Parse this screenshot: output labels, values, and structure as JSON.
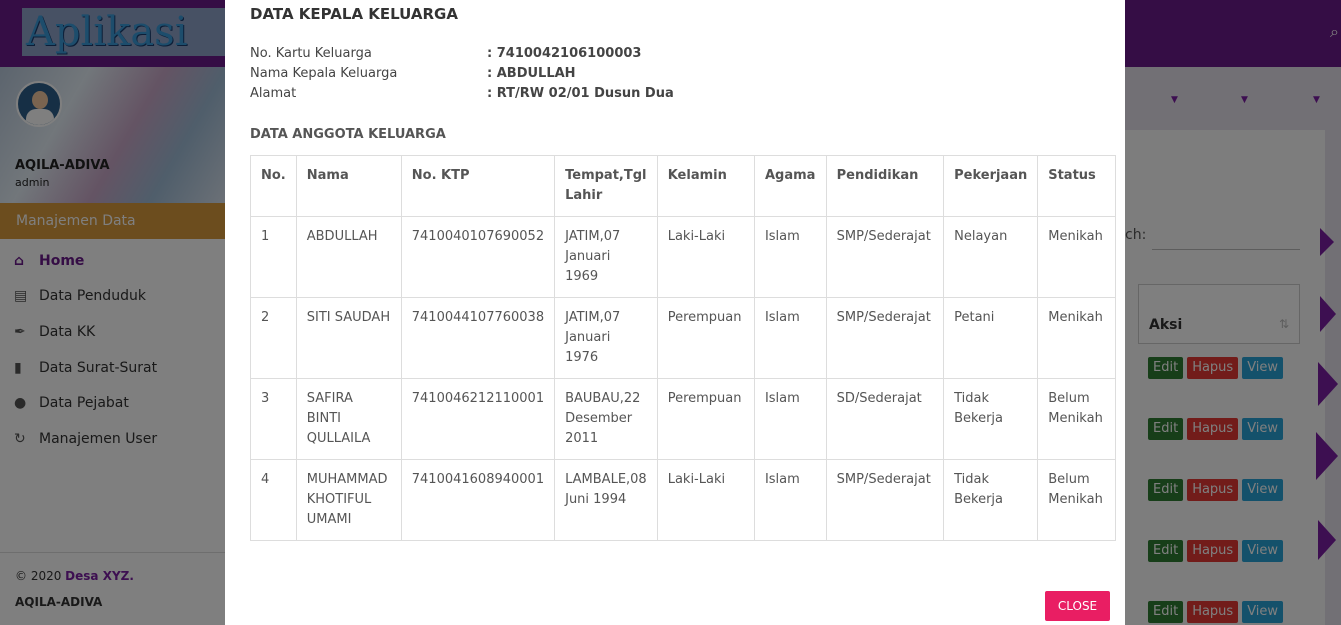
{
  "app": {
    "logo_text": "Aplikasi Admin",
    "profile_name": "AQILA-ADIVA",
    "profile_role": "admin",
    "menu_header": "Manajemen Data",
    "menu": [
      {
        "label": "Home",
        "icon": "home-icon"
      },
      {
        "label": "Data Penduduk",
        "icon": "list-icon"
      },
      {
        "label": "Data KK",
        "icon": "paperclip-icon"
      },
      {
        "label": "Data Surat-Surat",
        "icon": "file-icon"
      },
      {
        "label": "Data Pejabat",
        "icon": "user-icon"
      },
      {
        "label": "Manajemen User",
        "icon": "refresh-icon"
      }
    ],
    "footer": {
      "copyright": "© 2020 ",
      "brand": "Desa XYZ.",
      "app_name": "AQILA-ADIVA"
    },
    "search_label": "ch:",
    "aksi_header": "Aksi",
    "row_buttons": {
      "edit": "Edit",
      "hapus": "Hapus",
      "view": "View"
    },
    "colors": {
      "primary": "#6a1b8a",
      "edit": "#2e7d32",
      "hapus": "#e53935",
      "view": "#29a3d6",
      "close": "#e91e63"
    }
  },
  "modal": {
    "title": "DATA KEPALA KELUARGA",
    "info": [
      {
        "label": "No. Kartu Keluarga",
        "value": ": 7410042106100003"
      },
      {
        "label": "Nama Kepala Keluarga",
        "value": ": ABDULLAH"
      },
      {
        "label": "Alamat",
        "value": ": RT/RW 02/01 Dusun Dua"
      }
    ],
    "members_title": "DATA ANGGOTA KELUARGA",
    "columns": [
      "No.",
      "Nama",
      "No. KTP",
      "Tempat,Tgl Lahir",
      "Kelamin",
      "Agama",
      "Pendidikan",
      "Pekerjaan",
      "Status"
    ],
    "rows": [
      [
        "1",
        "ABDULLAH",
        "7410040107690052",
        "JATIM,07 Januari 1969",
        "Laki-Laki",
        "Islam",
        "SMP/Sederajat",
        "Nelayan",
        "Menikah"
      ],
      [
        "2",
        "SITI SAUDAH",
        "7410044107760038",
        "JATIM,07 Januari 1976",
        "Perempuan",
        "Islam",
        "SMP/Sederajat",
        "Petani",
        "Menikah"
      ],
      [
        "3",
        "SAFIRA BINTI QULLAILA",
        "7410046212110001",
        "BAUBAU,22 Desember 2011",
        "Perempuan",
        "Islam",
        "SD/Sederajat",
        "Tidak Bekerja",
        "Belum Menikah"
      ],
      [
        "4",
        "MUHAMMAD KHOTIFUL UMAMI",
        "7410041608940001",
        "LAMBALE,08 Juni 1994",
        "Laki-Laki",
        "Islam",
        "SMP/Sederajat",
        "Tidak Bekerja",
        "Belum Menikah"
      ]
    ],
    "close_label": "CLOSE"
  }
}
